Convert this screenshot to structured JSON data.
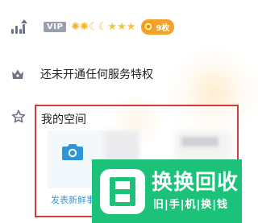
{
  "level_row": {
    "vip_label": "VIP",
    "badges": [
      {
        "icon": "sun-icon",
        "glyph": "✺",
        "kind": "sun"
      },
      {
        "icon": "sun-icon",
        "glyph": "✺",
        "kind": "sun"
      },
      {
        "icon": "moon-icon",
        "glyph": "☾",
        "kind": "moon"
      },
      {
        "icon": "moon-icon",
        "glyph": "☾",
        "kind": "moon"
      },
      {
        "icon": "star-icon",
        "glyph": "★",
        "kind": "star"
      },
      {
        "icon": "star-icon",
        "glyph": "★",
        "kind": "star"
      },
      {
        "icon": "star-icon",
        "glyph": "★",
        "kind": "star"
      }
    ],
    "coins_label": "9枚"
  },
  "privileges": {
    "text": "还未开通任何服务特权"
  },
  "my_space": {
    "title": "我的空间",
    "publish_label": "发表新鲜事"
  },
  "watermark": {
    "title": "换换回收",
    "subtitle": "旧|手|机|换|钱"
  },
  "colors": {
    "accent_blue": "#3a98d8",
    "highlight_red": "#d8383a",
    "coin_orange": "#f6a12c",
    "watermark_green": "#1cc17a",
    "icon_gray": "#6f7385"
  }
}
